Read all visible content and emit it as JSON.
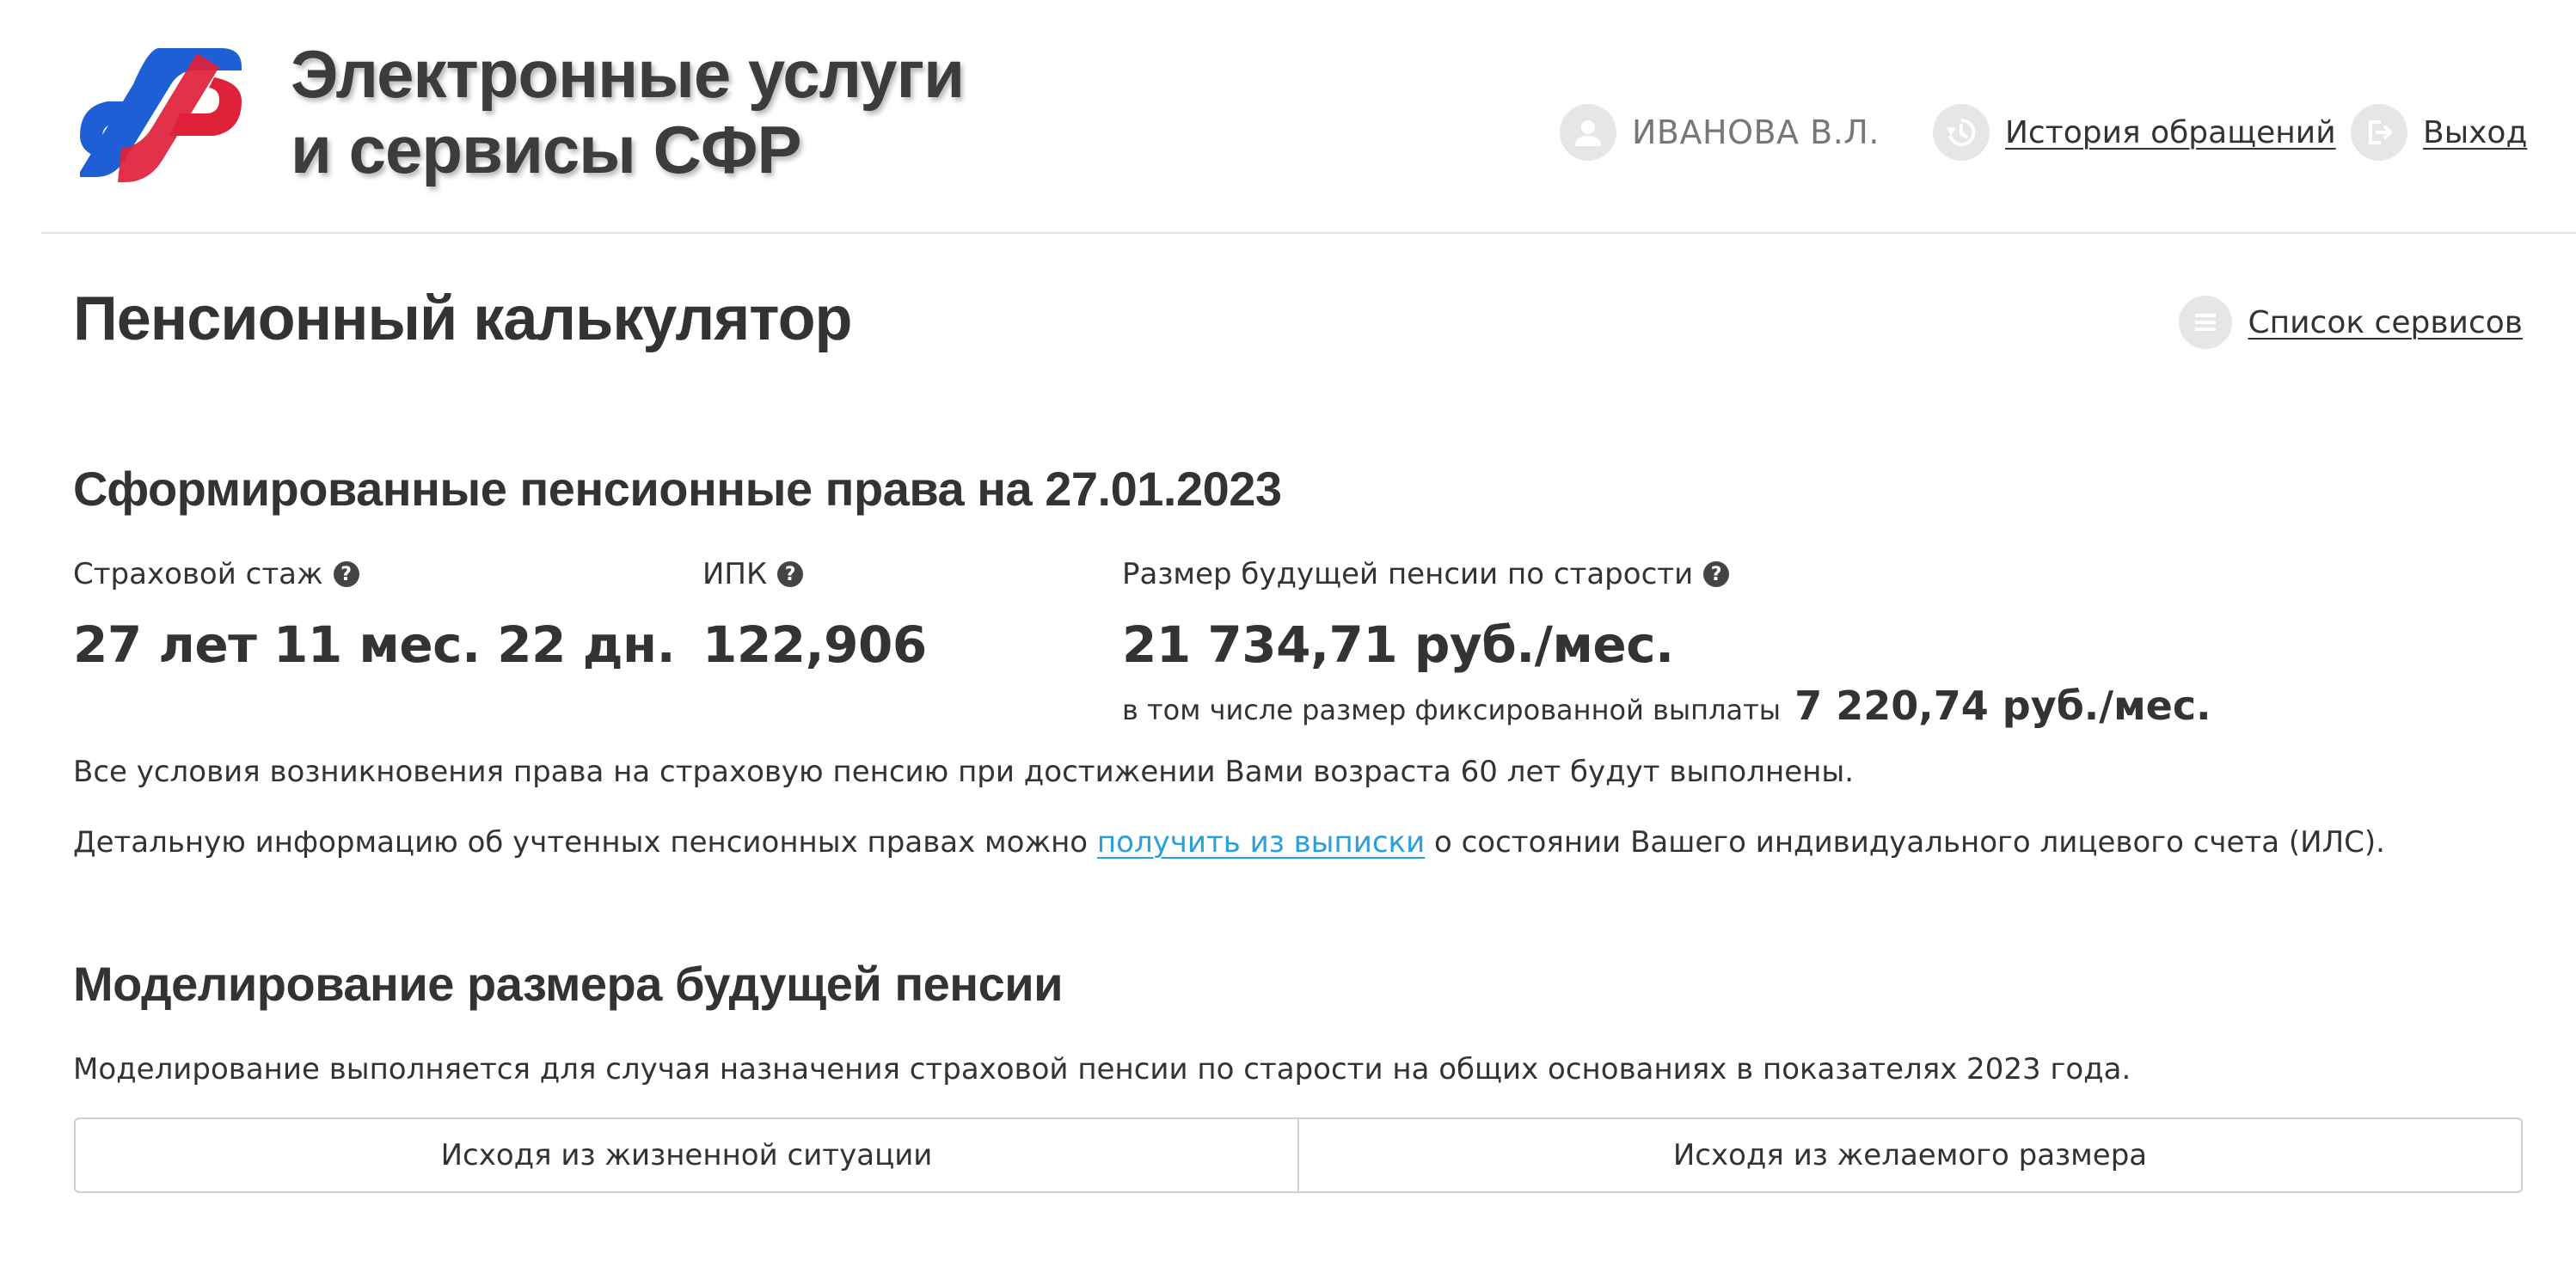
{
  "header": {
    "brand_line1": "Электронные услуги",
    "brand_line2": "и сервисы СФР",
    "logo_colors": {
      "blue": "#1f5fd6",
      "red": "#e0213a"
    },
    "user": {
      "name": "ИВАНОВА В.Л.",
      "icon": "user-icon"
    },
    "history": {
      "label": "История обращений",
      "icon": "history-icon"
    },
    "logout": {
      "label": "Выход",
      "icon": "logout-icon"
    }
  },
  "page": {
    "title": "Пенсионный калькулятор",
    "services_link": {
      "label": "Список сервисов",
      "icon": "list-icon"
    }
  },
  "rights": {
    "title": "Сформированные пенсионные права на 27.01.2023",
    "experience": {
      "label": "Страховой стаж",
      "value": "27 лет 11 мес. 22 дн."
    },
    "ipk": {
      "label": "ИПК",
      "value": "122,906"
    },
    "pension": {
      "label": "Размер будущей пенсии по старости",
      "value": "21 734,71 руб./мес.",
      "fixed_prefix": "в том числе размер фиксированной выплаты",
      "fixed_value": "7 220,74 руб./мес."
    },
    "conditions_text": "Все условия возникновения права на страховую пенсию при достижении Вами возраста 60 лет будут выполнены.",
    "details_before": "Детальную информацию об учтенных пенсионных правах можно ",
    "details_link": "получить из выписки",
    "details_after": " о состоянии Вашего индивидуального лицевого счета (ИЛС).",
    "link_color": "#2b9fd8"
  },
  "modeling": {
    "title": "Моделирование размера будущей пенсии",
    "description": "Моделирование выполняется для случая назначения страховой пенсии по старости на общих основаниях в показателях 2023 года.",
    "tabs": [
      {
        "label": "Исходя из жизненной ситуации"
      },
      {
        "label": "Исходя из желаемого размера"
      }
    ]
  }
}
